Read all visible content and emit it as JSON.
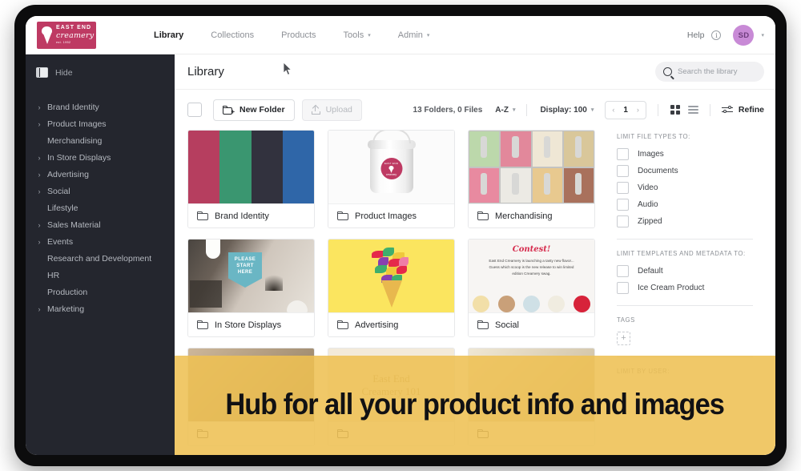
{
  "brand": {
    "logo_line1": "EAST END",
    "logo_line2": "creamery",
    "logo_line3": "est. 1952",
    "logo_color": "#be3a63"
  },
  "topnav": {
    "items": [
      {
        "label": "Library",
        "active": true,
        "has_caret": false
      },
      {
        "label": "Collections",
        "active": false,
        "has_caret": false
      },
      {
        "label": "Products",
        "active": false,
        "has_caret": false
      },
      {
        "label": "Tools",
        "active": false,
        "has_caret": true
      },
      {
        "label": "Admin",
        "active": false,
        "has_caret": true
      }
    ],
    "help_label": "Help",
    "avatar_initials": "SD",
    "avatar_color": "#c88ad6",
    "caret": "⌄"
  },
  "sidebar": {
    "hide_label": "Hide",
    "items": [
      {
        "label": "Brand Identity",
        "expandable": true
      },
      {
        "label": "Product Images",
        "expandable": true
      },
      {
        "label": "Merchandising",
        "expandable": false
      },
      {
        "label": "In Store Displays",
        "expandable": true
      },
      {
        "label": "Advertising",
        "expandable": true
      },
      {
        "label": "Social",
        "expandable": true
      },
      {
        "label": "Lifestyle",
        "expandable": false
      },
      {
        "label": "Sales Material",
        "expandable": true
      },
      {
        "label": "Events",
        "expandable": true
      },
      {
        "label": "Research and Development",
        "expandable": false
      },
      {
        "label": "HR",
        "expandable": false
      },
      {
        "label": "Production",
        "expandable": false
      },
      {
        "label": "Marketing",
        "expandable": true
      }
    ],
    "chevron": "›"
  },
  "content": {
    "page_title": "Library",
    "search_placeholder": "Search the library",
    "search_value": ""
  },
  "toolbar": {
    "new_folder_label": "New Folder",
    "upload_label": "Upload",
    "count_label": "13 Folders, 0 Files",
    "sort_label": "A-Z",
    "display_label": "Display: 100",
    "page_number": "1",
    "prev_arrow": "‹",
    "next_arrow": "›",
    "refine_label": "Refine",
    "caret": "⌄"
  },
  "cards": [
    {
      "name": "Brand Identity",
      "art": "swatches"
    },
    {
      "name": "Product Images",
      "art": "tub"
    },
    {
      "name": "Merchandising",
      "art": "gelato"
    },
    {
      "name": "In Store Displays",
      "art": "store"
    },
    {
      "name": "Advertising",
      "art": "advert"
    },
    {
      "name": "Social",
      "art": "contest"
    }
  ],
  "card_art": {
    "swatch_colors": [
      "#b63e5f",
      "#3a9670",
      "#32323e",
      "#2f66a8"
    ],
    "store_banner_lines": [
      "PLEASE",
      "START",
      "HERE"
    ],
    "contest_title": "Contest!",
    "contest_body": "East End Creamery is launching a tasty new flavor... Guess which scoop is the new release to win limited edition Creamery swag.",
    "scoop_colors": [
      "#f2dfa8",
      "#c9a079",
      "#cfe0e6",
      "#f0ece0",
      "#d7233a"
    ],
    "tub_badge_top": "EAST END",
    "tub_badge_name": "creamery"
  },
  "hidden_card": {
    "name_line1": "East End",
    "name_line2": "Creamery 101"
  },
  "filters": {
    "file_types_head": "LIMIT FILE TYPES TO:",
    "file_types": [
      "Images",
      "Documents",
      "Video",
      "Audio",
      "Zipped"
    ],
    "templates_head": "LIMIT TEMPLATES AND METADATA TO:",
    "templates": [
      "Default",
      "Ice Cream Product"
    ],
    "tags_head": "TAGS",
    "tag_add": "+",
    "user_head": "LIMIT BY USER:"
  },
  "overlay": {
    "text": "Hub for all your product info and images",
    "background_color": "#eec053"
  }
}
